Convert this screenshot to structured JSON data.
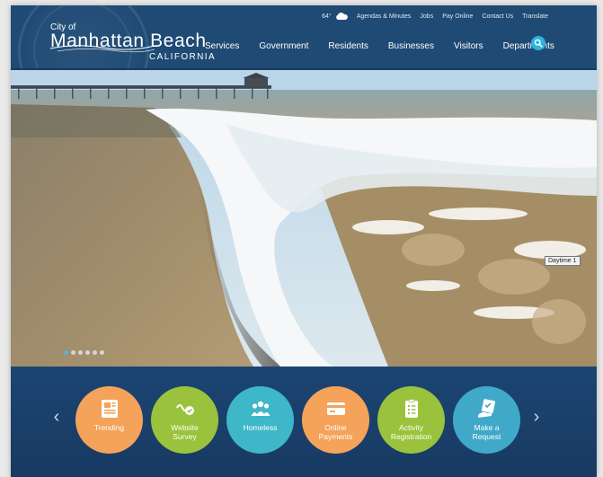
{
  "branding": {
    "city_of": "City of",
    "city_name": "Manhattan Beach",
    "state": "CALIFORNIA"
  },
  "topbar": {
    "temperature": "64°",
    "weather_icon": "cloud-icon",
    "links": [
      "Agendas & Minutes",
      "Jobs",
      "Pay Online",
      "Contact Us",
      "Translate"
    ]
  },
  "nav": {
    "items": [
      "Services",
      "Government",
      "Residents",
      "Businesses",
      "Visitors",
      "Departments"
    ],
    "search_icon": "search-icon"
  },
  "hero": {
    "slide_count": 6,
    "active_slide": 1,
    "tooltip": "Daytime 1"
  },
  "quick_links": {
    "prev_arrow": "‹",
    "next_arrow": "›",
    "items": [
      {
        "label": "Trending",
        "icon": "newspaper-icon",
        "color": "#f5a25a"
      },
      {
        "label": "Website\nSurvey",
        "icon": "survey-icon",
        "color": "#9bc23c"
      },
      {
        "label": "Homeless",
        "icon": "people-icon",
        "color": "#3eb7c8"
      },
      {
        "label": "Online\nPayments",
        "icon": "credit-card-icon",
        "color": "#f5a25a"
      },
      {
        "label": "Activity\nRegistration",
        "icon": "clipboard-icon",
        "color": "#9bc23c"
      },
      {
        "label": "Make a\nRequest",
        "icon": "request-icon",
        "color": "#40a9c9"
      }
    ]
  },
  "colors": {
    "header_bg": "#1e4a74",
    "accent": "#2fb4dc",
    "quick_bg": "#1a3f69"
  }
}
